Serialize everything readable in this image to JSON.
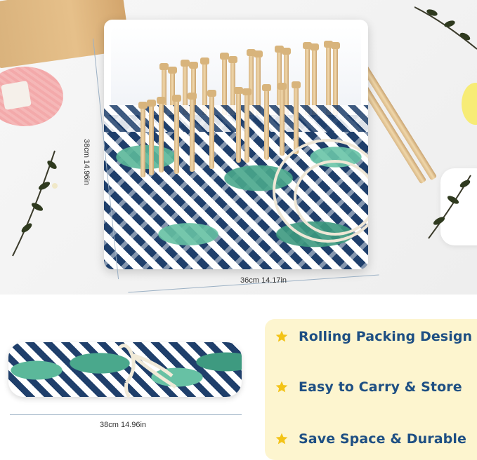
{
  "top_dimensions": {
    "height_label": "38cm 14.96in",
    "width_label": "36cm 14.17in"
  },
  "bottom_dimensions": {
    "length_label": "38cm 14.96in"
  },
  "features": [
    {
      "icon": "star-icon",
      "label": "Rolling Packing Design"
    },
    {
      "icon": "star-icon",
      "label": "Easy to Carry & Store"
    },
    {
      "icon": "star-icon",
      "label": "Save Space & Durable"
    }
  ],
  "colors": {
    "feature_text": "#1e4f83",
    "feature_panel_bg": "#fdf5cf",
    "star": "#f3c316",
    "fabric_navy": "#1f3f6b",
    "leaf_green": "#4aa88c"
  }
}
